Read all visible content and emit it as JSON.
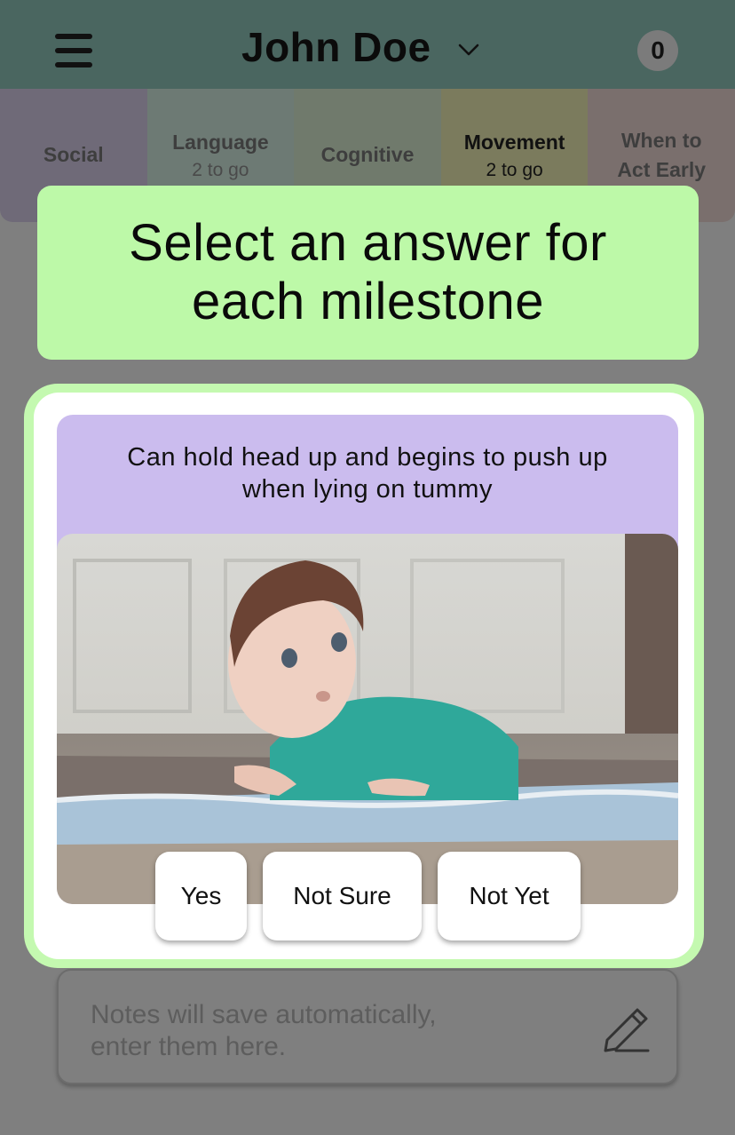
{
  "header": {
    "child_name": "John Doe",
    "badge_count": "0",
    "icons": {
      "menu": "hamburger-icon",
      "dropdown": "chevron-down-icon"
    }
  },
  "tabs": [
    {
      "label": "Social",
      "sub": ""
    },
    {
      "label": "Language",
      "sub": "2 to go"
    },
    {
      "label": "Cognitive",
      "sub": ""
    },
    {
      "label": "Movement",
      "sub": "2 to go"
    },
    {
      "label_line1": "When to",
      "label_line2": "Act Early"
    }
  ],
  "banner": {
    "line1": "Select an answer for",
    "line2": "each milestone"
  },
  "milestone": {
    "line1": "Can hold head up and begins to push up",
    "line2": "when lying on tummy"
  },
  "answers": {
    "yes": "Yes",
    "not_sure": "Not Sure",
    "not_yet": "Not Yet"
  },
  "notes": {
    "placeholder_line1": "Notes will save automatically,",
    "placeholder_line2": "enter them here.",
    "icon": "pencil-icon"
  },
  "colors": {
    "header_bg": "#4a6660",
    "banner_bg": "#bdf9a8",
    "milestone_bg": "#cbbcee",
    "card_border": "#c4f9b0"
  }
}
